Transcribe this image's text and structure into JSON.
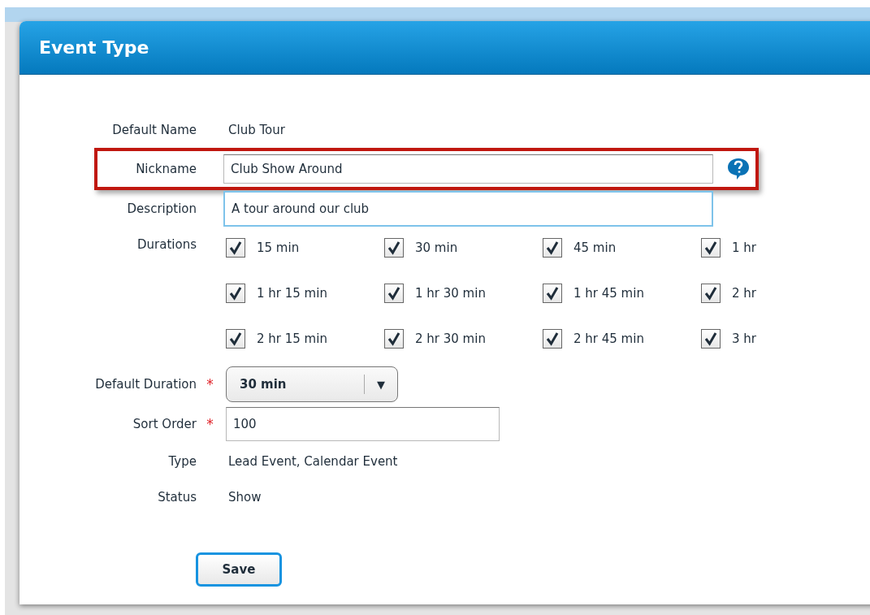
{
  "dialog": {
    "title": "Event Type"
  },
  "fields": [
    {
      "kind": "text",
      "label": "Default Name",
      "value": "Club Tour"
    },
    {
      "kind": "input",
      "label": "Nickname",
      "value": "Club Show Around",
      "highlighted": true,
      "help": true,
      "focused": false
    },
    {
      "kind": "input",
      "label": "Description",
      "value": "A tour around our club",
      "highlighted": false,
      "help": false,
      "focused": true
    }
  ],
  "durations": {
    "label": "Durations",
    "options": [
      {
        "label": "15 min",
        "checked": true
      },
      {
        "label": "30 min",
        "checked": true
      },
      {
        "label": "45 min",
        "checked": true
      },
      {
        "label": "1 hr",
        "checked": true
      },
      {
        "label": "1 hr 15 min",
        "checked": true
      },
      {
        "label": "1 hr 30 min",
        "checked": true
      },
      {
        "label": "1 hr 45 min",
        "checked": true
      },
      {
        "label": "2 hr",
        "checked": true
      },
      {
        "label": "2 hr 15 min",
        "checked": true
      },
      {
        "label": "2 hr 30 min",
        "checked": true
      },
      {
        "label": "2 hr 45 min",
        "checked": true
      },
      {
        "label": "3 hr",
        "checked": true
      }
    ]
  },
  "default_duration": {
    "label": "Default Duration",
    "required_mark": "*",
    "value": "30 min",
    "arrow": "▼"
  },
  "sort_order": {
    "label": "Sort Order",
    "required_mark": "*",
    "value": "100"
  },
  "info": [
    {
      "label": "Type",
      "value": "Lead Event, Calendar Event"
    },
    {
      "label": "Status",
      "value": "Show"
    }
  ],
  "save_button": "Save"
}
